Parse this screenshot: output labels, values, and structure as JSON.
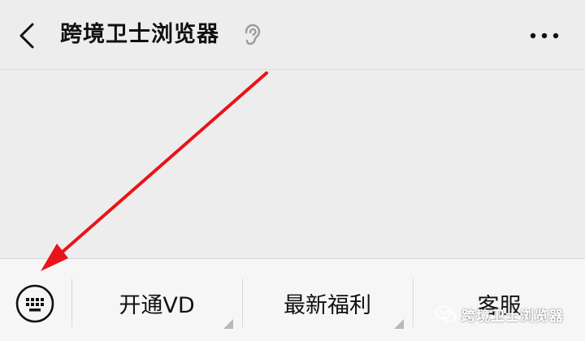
{
  "header": {
    "title": "跨境卫士浏览器",
    "back_icon": "chevron-left-icon",
    "listen_icon": "ear-icon",
    "more_icon": "more-dots-icon"
  },
  "menu": {
    "keyboard_icon": "keyboard-icon",
    "items": [
      {
        "label": "开通VD"
      },
      {
        "label": "最新福利"
      },
      {
        "label": "客服"
      }
    ]
  },
  "watermark": {
    "text": "跨境卫士浏览器",
    "icon": "wechat-icon"
  },
  "annotation": {
    "arrow_color": "#e8141a"
  }
}
